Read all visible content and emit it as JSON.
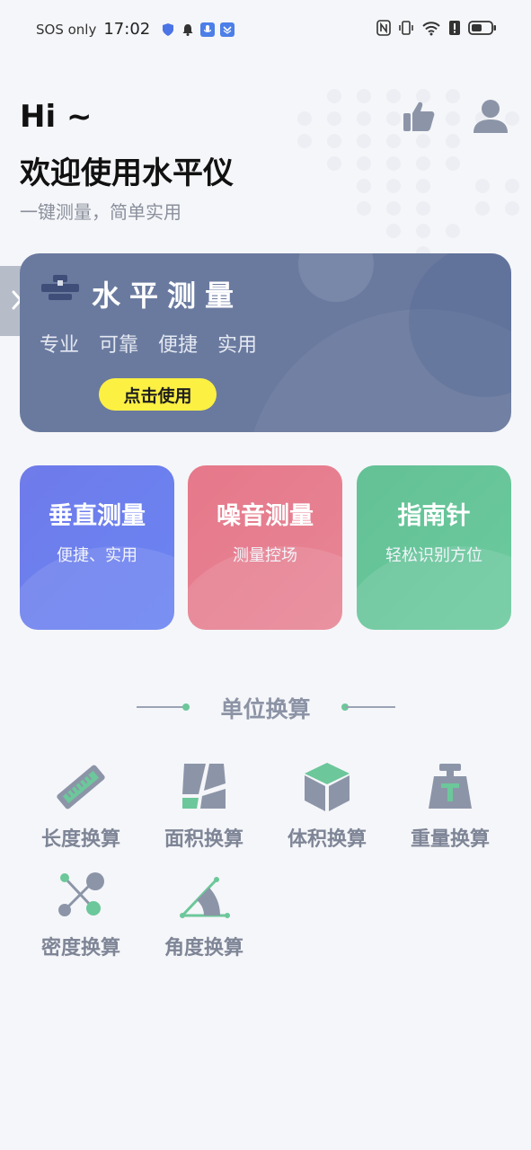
{
  "status_bar": {
    "carrier": "SOS only",
    "time": "17:02"
  },
  "header": {
    "greeting": "Hi ~",
    "welcome": "欢迎使用水平仪",
    "tagline": "一键测量，简单实用"
  },
  "banner": {
    "title": "水平测量",
    "features": [
      "专业",
      "可靠",
      "便捷",
      "实用"
    ],
    "cta": "点击使用"
  },
  "cards": [
    {
      "title": "垂直测量",
      "subtitle": "便捷、实用",
      "color": "#6F7BEA"
    },
    {
      "title": "噪音测量",
      "subtitle": "测量控场",
      "color": "#E6788A"
    },
    {
      "title": "指南针",
      "subtitle": "轻松识别方位",
      "color": "#63C195"
    }
  ],
  "section": {
    "title": "单位换算"
  },
  "tools": [
    {
      "label": "长度换算",
      "icon": "ruler-icon"
    },
    {
      "label": "面积换算",
      "icon": "area-icon"
    },
    {
      "label": "体积换算",
      "icon": "cube-icon"
    },
    {
      "label": "重量换算",
      "icon": "weight-icon"
    },
    {
      "label": "密度换算",
      "icon": "density-icon"
    },
    {
      "label": "角度换算",
      "icon": "angle-icon"
    }
  ],
  "colors": {
    "accent_green": "#6CC79A",
    "icon_gray": "#8C95A8",
    "cta_yellow": "#FCF043",
    "banner": "#6A7A9F"
  }
}
